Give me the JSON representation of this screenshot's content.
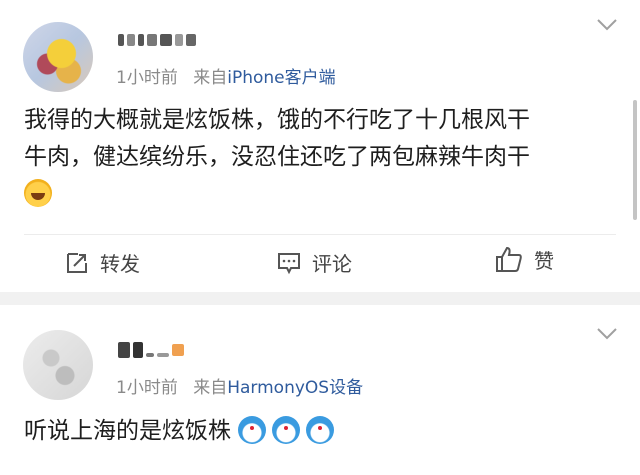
{
  "posts": [
    {
      "time": "1小时前",
      "source_prefix": "来自",
      "source": "iPhone客户端",
      "text_line1": "我得的大概就是炫饭株，饿的不行吃了十几根风干",
      "text_line2": "牛肉，健达缤纷乐，没忍住还吃了两包麻辣牛肉干",
      "emojis": [
        "laugh-cry-emoji"
      ],
      "actions": {
        "repost": "转发",
        "comment": "评论",
        "like": "赞"
      }
    },
    {
      "time": "1小时前",
      "source_prefix": "来自",
      "source": "HarmonyOS设备",
      "text": "听说上海的是炫饭株",
      "emojis": [
        "doraemon-emoji",
        "doraemon-emoji",
        "doraemon-emoji"
      ]
    }
  ],
  "colors": {
    "source_link": "#2f5b9d",
    "meta_gray": "#8a8a8a",
    "separator": "#f1f1f1"
  }
}
